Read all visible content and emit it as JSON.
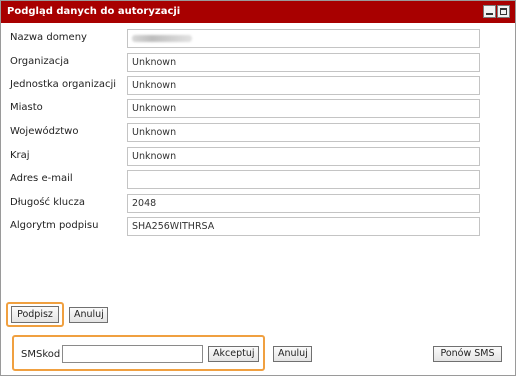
{
  "dialog": {
    "title": "Podgląd danych do autoryzacji"
  },
  "fields": [
    {
      "label": "Nazwa domeny",
      "value": "",
      "redacted": true
    },
    {
      "label": "Organizacja",
      "value": "Unknown"
    },
    {
      "label": "Jednostka organizacji",
      "value": "Unknown"
    },
    {
      "label": "Miasto",
      "value": "Unknown"
    },
    {
      "label": "Województwo",
      "value": "Unknown"
    },
    {
      "label": "Kraj",
      "value": "Unknown"
    },
    {
      "label": "Adres e-mail",
      "value": ""
    },
    {
      "label": "Długość klucza",
      "value": "2048"
    },
    {
      "label": "Algorytm podpisu",
      "value": "SHA256WITHRSA"
    }
  ],
  "actions": {
    "sign_label": "Podpisz",
    "cancel_label": "Anuluj"
  },
  "sms": {
    "label": "SMSkod",
    "value": "",
    "accept_label": "Akceptuj",
    "cancel_label": "Anuluj",
    "resend_label": "Ponów SMS"
  },
  "colors": {
    "titlebar": "#a80000",
    "highlight": "#f0a040"
  }
}
